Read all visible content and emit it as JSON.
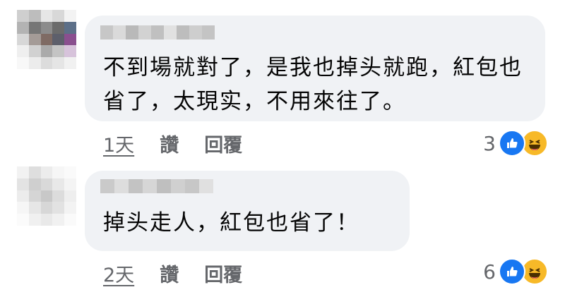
{
  "comments": [
    {
      "text": "不到場就對了，是我也掉头就跑，紅包也省了，太現实，不用來往了。",
      "time": "1天",
      "like_label": "讚",
      "reply_label": "回覆",
      "reaction_count": "3",
      "reactions": [
        "like-icon",
        "haha-icon"
      ]
    },
    {
      "text": "掉头走人，紅包也省了！",
      "time": "2天",
      "like_label": "讚",
      "reply_label": "回覆",
      "reaction_count": "6",
      "reactions": [
        "like-icon",
        "haha-icon"
      ]
    }
  ],
  "colors": {
    "bubble": "#f0f2f5",
    "meta_text": "#65676b",
    "like_blue": "#1877f2",
    "haha_yellow": "#f7b928"
  }
}
